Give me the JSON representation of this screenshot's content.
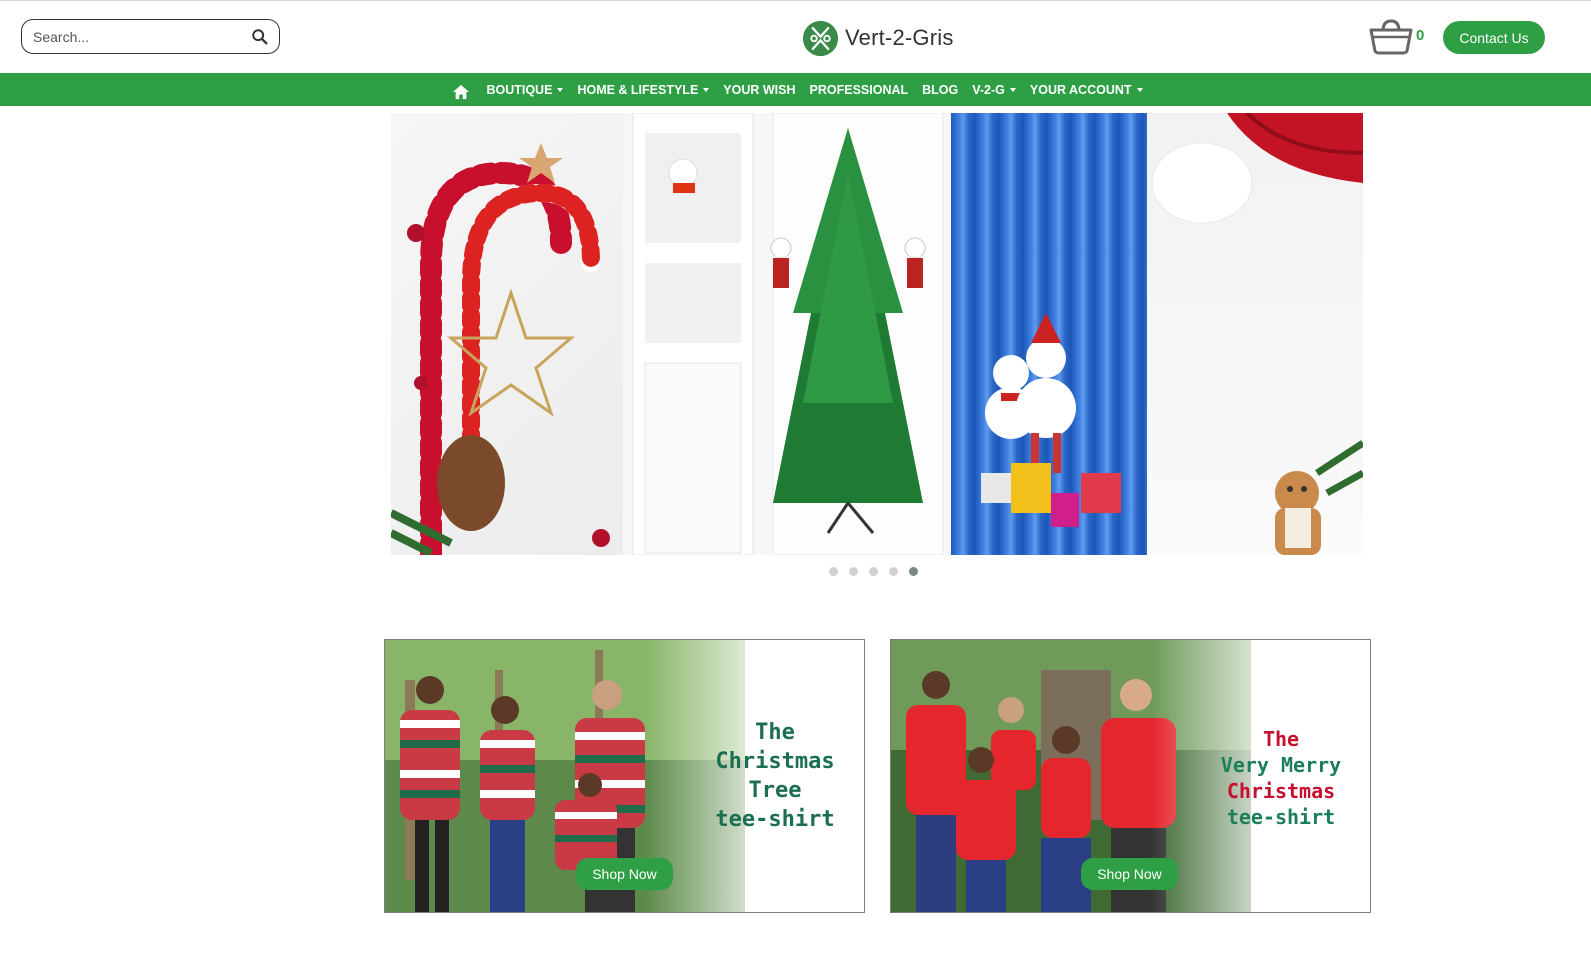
{
  "header": {
    "search_placeholder": "Search...",
    "logo_text": "Vert-2-Gris",
    "cart_count": "0",
    "contact_label": "Contact Us"
  },
  "nav": {
    "items": [
      {
        "label": "BOUTIQUE",
        "dropdown": true
      },
      {
        "label": "HOME & LIFESTYLE",
        "dropdown": true
      },
      {
        "label": "YOUR WISH",
        "dropdown": false
      },
      {
        "label": "PROFESSIONAL",
        "dropdown": false
      },
      {
        "label": "BLOG",
        "dropdown": false
      },
      {
        "label": "V-2-G",
        "dropdown": true
      },
      {
        "label": "YOUR ACCOUNT",
        "dropdown": true
      }
    ]
  },
  "carousel": {
    "slide_count": 5,
    "active_index": 4
  },
  "promos": [
    {
      "title_lines": [
        "The",
        "Christmas",
        "Tree",
        "tee-shirt"
      ],
      "button": "Shop Now"
    },
    {
      "title_lines": [
        "The",
        "Very Merry",
        "Christmas",
        "tee-shirt"
      ],
      "button": "Shop Now"
    }
  ],
  "colors": {
    "brand_green": "#2e9f45",
    "promo_red": "#c8102e",
    "promo_green": "#1b6e52"
  },
  "icons": {
    "search": "search-icon",
    "cart": "basket-icon",
    "home": "home-icon"
  }
}
